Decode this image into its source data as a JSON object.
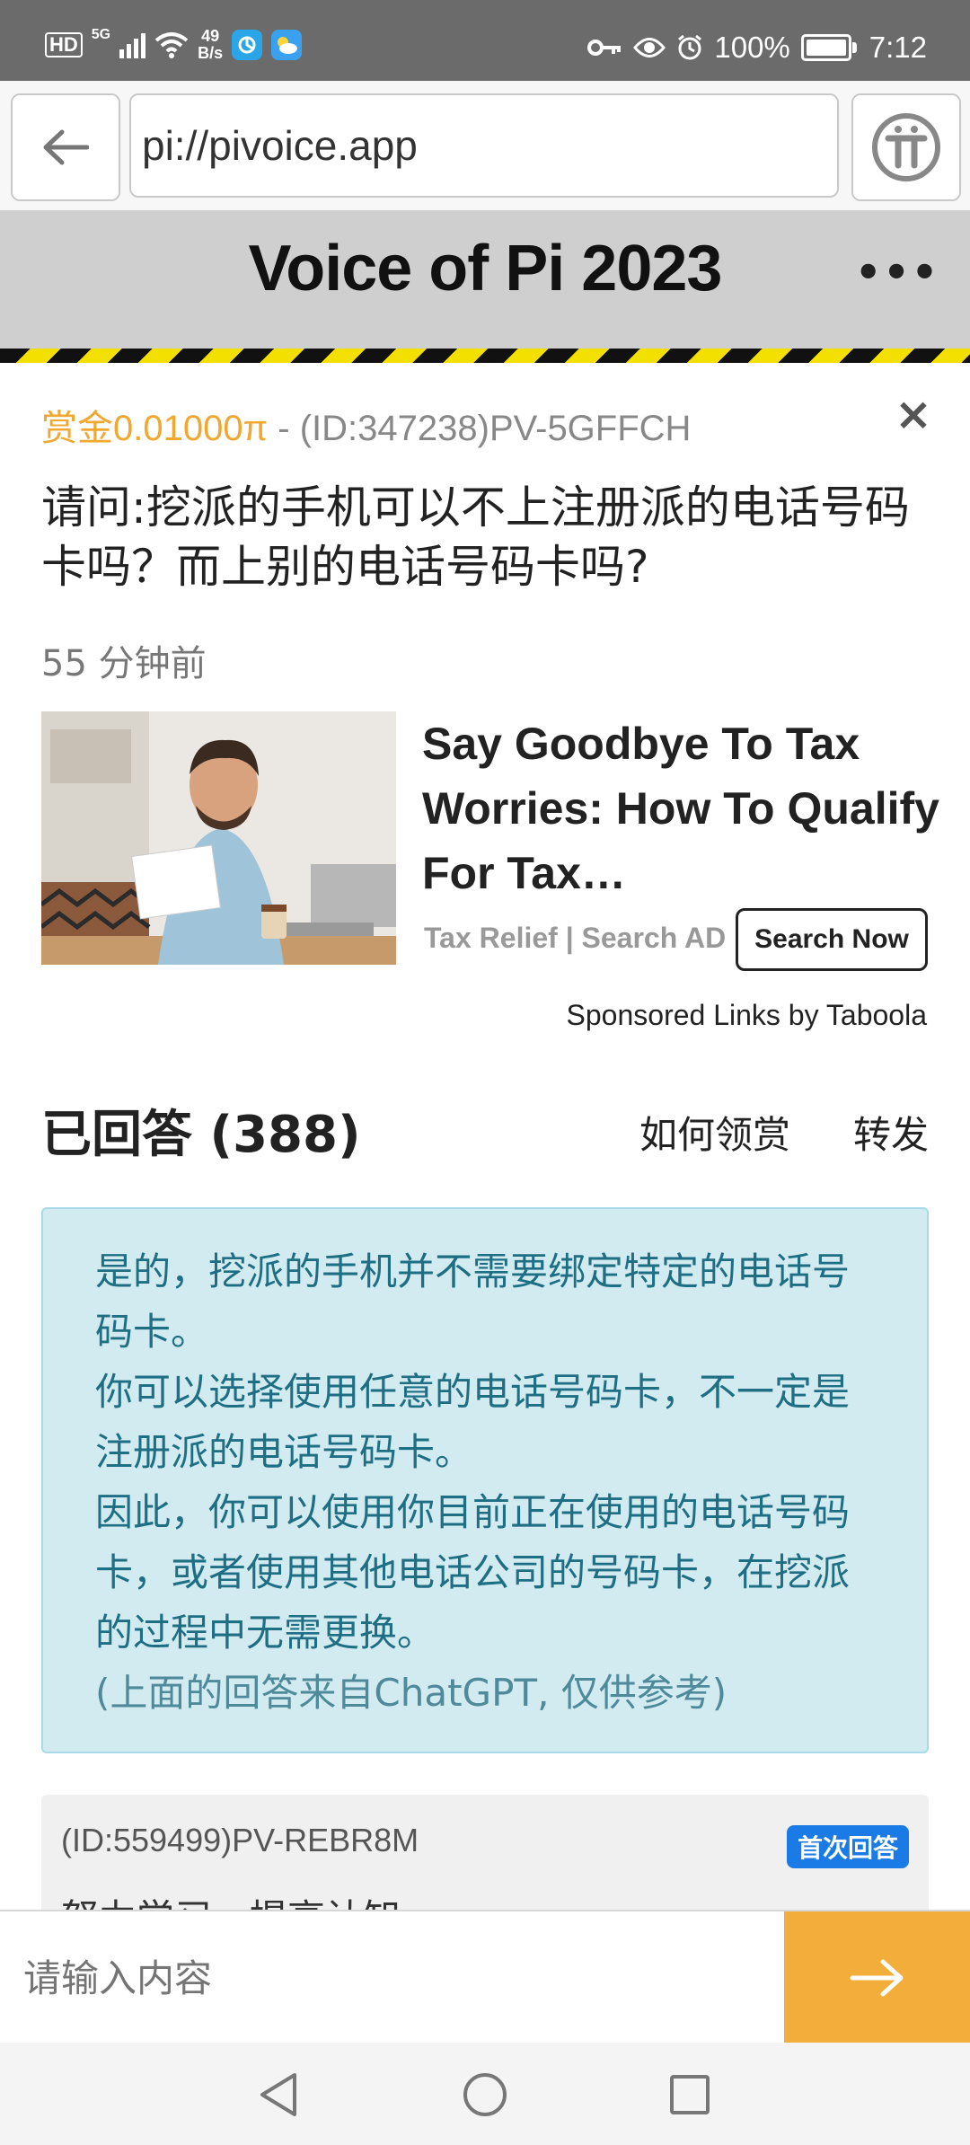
{
  "status_bar": {
    "hd": "HD",
    "network_type": "5G",
    "net_speed_value": "49",
    "net_speed_unit": "B/s",
    "battery": "100%",
    "time": "7:12"
  },
  "browser": {
    "url": "pi://pivoice.app"
  },
  "site": {
    "title": "Voice of Pi 2023",
    "menu_label": "•••"
  },
  "question": {
    "bounty": "赏金0.01000π",
    "separator": " - ",
    "id": "(ID:347238)PV-5GFFCH",
    "close_label": "×",
    "text": "请问:挖派的手机可以不上注册派的电话号码卡吗？而上别的电话号码卡吗?",
    "time_ago": "55 分钟前"
  },
  "ad": {
    "title": "Say Goodbye To Tax Worries: How To Qualify For Tax…",
    "source": "Tax Relief | Search AD",
    "button": "Search Now",
    "sponsored": "Sponsored Links by Taboola"
  },
  "answers": {
    "header": "已回答 (388)",
    "how_to_reward": "如何领赏",
    "share": "转发"
  },
  "ai_answer": {
    "p1": "是的，挖派的手机并不需要绑定特定的电话号码卡。",
    "p2": "你可以选择使用任意的电话号码卡，不一定是注册派的电话号码卡。",
    "p3": "因此，你可以使用你目前正在使用的电话号码卡，或者使用其他电话公司的号码卡，在挖派的过程中无需更换。",
    "note": "(上面的回答来自ChatGPT, 仅供参考)"
  },
  "first_answer": {
    "id": "(ID:559499)PV-REBR8M",
    "badge": "首次回答",
    "text": "努力学习，提高认知"
  },
  "input": {
    "placeholder": "请输入内容"
  },
  "colors": {
    "bounty": "#f0a830",
    "ai_card_bg": "#d2ebf0",
    "ai_text": "#1e6e84",
    "send_button": "#f3ad3b",
    "badge": "#1a7be6"
  }
}
